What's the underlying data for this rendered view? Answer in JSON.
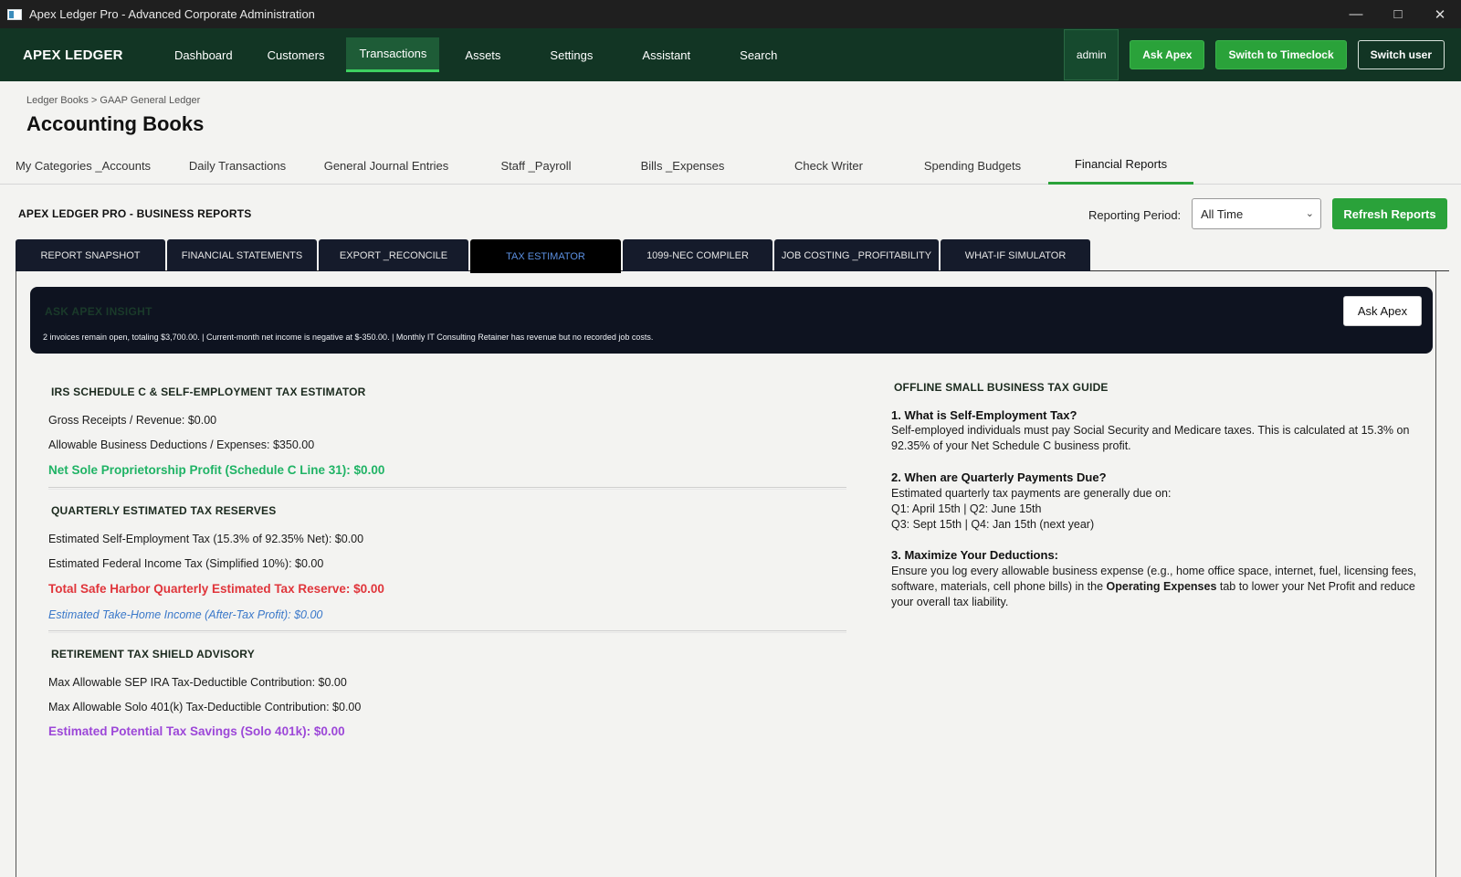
{
  "window": {
    "title": "Apex Ledger Pro - Advanced Corporate Administration",
    "controls": [
      "minimize-icon",
      "maximize-icon",
      "close-icon"
    ]
  },
  "topnav": {
    "brand": "APEX LEDGER",
    "items": [
      {
        "label": "Dashboard"
      },
      {
        "label": "Customers"
      },
      {
        "label": "Transactions",
        "active": true
      },
      {
        "label": "Assets"
      },
      {
        "label": "Settings"
      },
      {
        "label": "Assistant"
      },
      {
        "label": "Search"
      }
    ],
    "user": "admin",
    "ask_apex": "Ask Apex",
    "timeclock": "Switch to Timeclock",
    "switch_user": "Switch user"
  },
  "page": {
    "breadcrumb": "Ledger Books  >  GAAP General Ledger",
    "title": "Accounting Books"
  },
  "section_tabs": [
    {
      "label": "My Categories _Accounts"
    },
    {
      "label": "Daily Transactions"
    },
    {
      "label": "General Journal Entries"
    },
    {
      "label": "Staff _Payroll"
    },
    {
      "label": "Bills _Expenses"
    },
    {
      "label": "Check Writer"
    },
    {
      "label": "Spending Budgets"
    },
    {
      "label": "Financial Reports",
      "active": true
    }
  ],
  "reports": {
    "heading": "APEX LEDGER PRO - BUSINESS REPORTS",
    "period_label": "Reporting Period:",
    "period_value": "All Time",
    "refresh": "Refresh Reports",
    "tabs": [
      {
        "label": "REPORT SNAPSHOT"
      },
      {
        "label": "FINANCIAL STATEMENTS"
      },
      {
        "label": "EXPORT _RECONCILE"
      },
      {
        "label": "TAX ESTIMATOR",
        "active": true
      },
      {
        "label": "1099-NEC COMPILER"
      },
      {
        "label": "JOB COSTING _PROFITABILITY"
      },
      {
        "label": "WHAT-IF SIMULATOR"
      }
    ]
  },
  "insight": {
    "title": "ASK APEX INSIGHT",
    "text": "2 invoices remain open, totaling $3,700.00.  |  Current-month net income is negative at $-350.00.  |  Monthly IT Consulting Retainer has revenue but no recorded job costs.",
    "button": "Ask Apex"
  },
  "estimator": {
    "schedule_c": {
      "heading": "IRS SCHEDULE C & SELF-EMPLOYMENT TAX ESTIMATOR",
      "gross": "Gross Receipts / Revenue: $0.00",
      "deductions": "Allowable Business Deductions / Expenses: $350.00",
      "net_profit": "Net Sole Proprietorship Profit (Schedule C Line 31): $0.00"
    },
    "quarterly": {
      "heading": "QUARTERLY ESTIMATED TAX RESERVES",
      "se_tax": "Estimated Self-Employment Tax (15.3% of 92.35% Net): $0.00",
      "fed_tax": "Estimated Federal Income Tax (Simplified 10%): $0.00",
      "total_reserve": "Total Safe Harbor Quarterly Estimated Tax Reserve: $0.00",
      "take_home": "Estimated Take-Home Income (After-Tax Profit): $0.00"
    },
    "retirement": {
      "heading": "RETIREMENT TAX SHIELD ADVISORY",
      "sep": "Max Allowable SEP IRA Tax-Deductible Contribution: $0.00",
      "solo": "Max Allowable Solo 401(k) Tax-Deductible Contribution: $0.00",
      "savings": "Estimated Potential Tax Savings (Solo 401k): $0.00"
    }
  },
  "guide": {
    "title": "OFFLINE SMALL BUSINESS TAX GUIDE",
    "q1": "1. What is Self-Employment Tax?",
    "a1": "Self-employed individuals must pay Social Security and Medicare taxes. This is calculated at 15.3% on 92.35% of your Net Schedule C business profit.",
    "q2": "2. When are Quarterly Payments Due?",
    "a2_l1": "Estimated quarterly tax payments are generally due on:",
    "a2_l2": "Q1: April 15th | Q2: June 15th",
    "a2_l3": "Q3: Sept 15th | Q4: Jan 15th (next year)",
    "q3": "3. Maximize Your Deductions:",
    "a3_pre": "Ensure you log every allowable business expense (e.g., home office space, internet, fuel, licensing fees, software, materials, cell phone bills) in the ",
    "a3_bold": "Operating Expenses",
    "a3_post": " tab to lower your Net Profit and reduce your overall tax liability."
  }
}
